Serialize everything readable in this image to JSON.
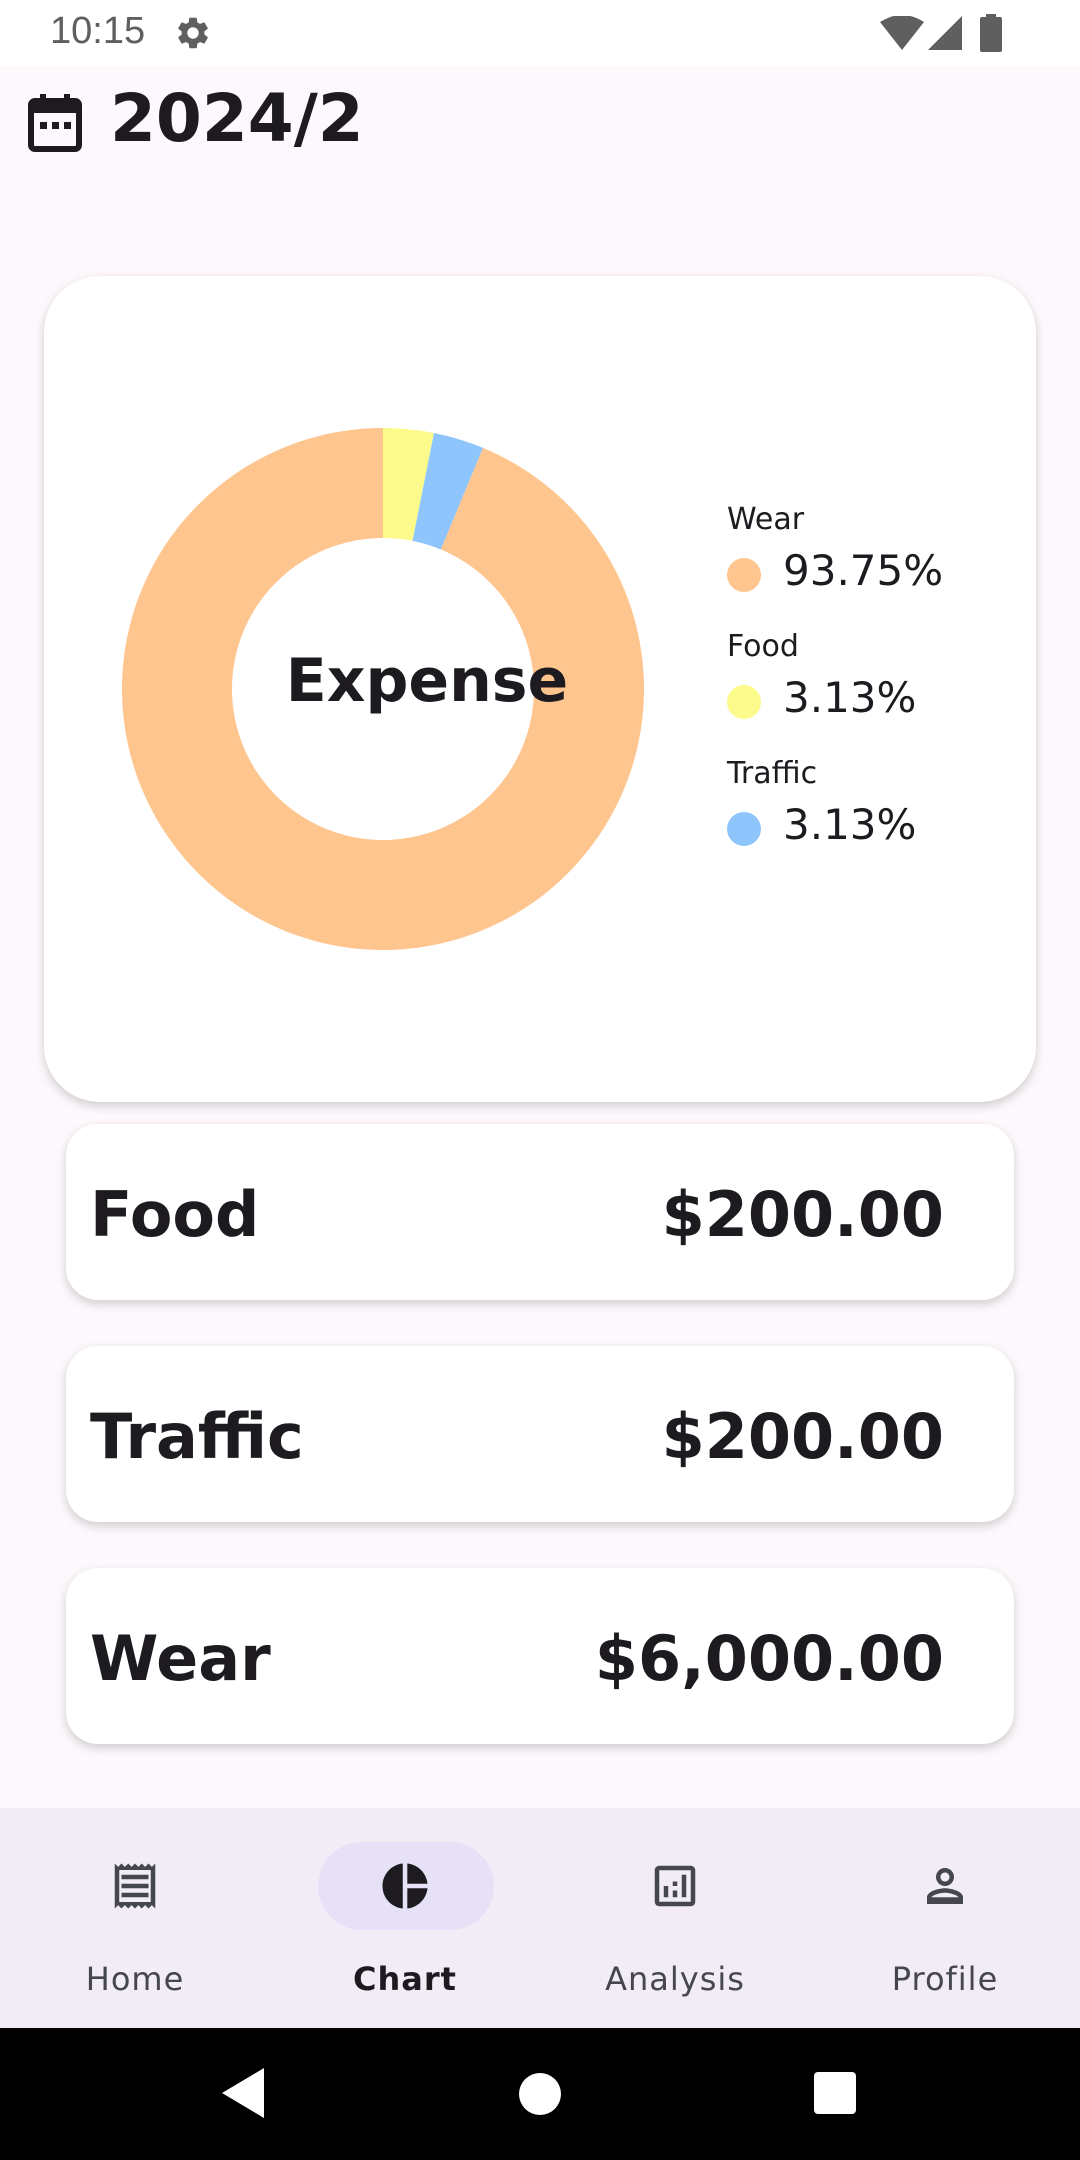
{
  "status_bar": {
    "time": "10:15",
    "icons": [
      "settings-gear-icon",
      "wifi-icon",
      "cellular-signal-icon",
      "battery-icon"
    ]
  },
  "header": {
    "title": "2024/2",
    "icon": "calendar-icon"
  },
  "chart_data": {
    "type": "pie",
    "title": "",
    "center_label": "Expense",
    "donut": true,
    "legend_position": "right",
    "categories": [
      "Wear",
      "Food",
      "Traffic"
    ],
    "values": [
      93.75,
      3.13,
      3.13
    ],
    "value_labels": [
      "93.75%",
      "3.13%",
      "3.13%"
    ],
    "colors": [
      "#ffc58e",
      "#fdfa8c",
      "#8ec5fc"
    ]
  },
  "expense_list": [
    {
      "name": "Food",
      "amount": "$200.00"
    },
    {
      "name": "Traffic",
      "amount": "$200.00"
    },
    {
      "name": "Wear",
      "amount": "$6,000.00"
    }
  ],
  "bottom_nav": {
    "active": "Chart",
    "items": [
      {
        "label": "Home",
        "icon": "receipt-icon"
      },
      {
        "label": "Chart",
        "icon": "pie-chart-icon"
      },
      {
        "label": "Analysis",
        "icon": "bar-chart-icon"
      },
      {
        "label": "Profile",
        "icon": "person-icon"
      }
    ]
  },
  "system_nav": {
    "icons": [
      "back-icon",
      "home-icon",
      "recents-icon"
    ]
  },
  "colors": {
    "background": "#fdf8fc",
    "card": "#ffffff",
    "nav_bar": "#f2ecf6",
    "nav_active_pill": "#e6e1f7",
    "text": "#1d1b20"
  }
}
